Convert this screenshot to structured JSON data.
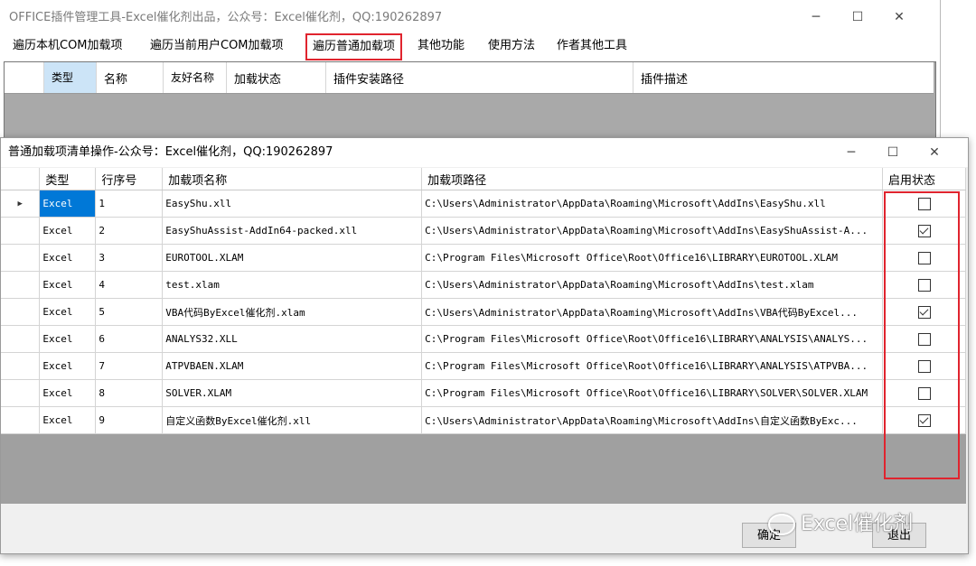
{
  "main_window": {
    "title": "OFFICE插件管理工具-Excel催化剂出品，公众号：Excel催化剂，QQ:190262897",
    "controls": {
      "minimize": "─",
      "maximize": "☐",
      "close": "✕"
    },
    "menu": [
      {
        "label": "遍历本机COM加载项"
      },
      {
        "label": "遍历当前用户COM加载项"
      },
      {
        "label": "遍历普通加载项"
      },
      {
        "label": "其他功能"
      },
      {
        "label": "使用方法"
      },
      {
        "label": "作者其他工具"
      }
    ],
    "grid_headers": [
      "类型",
      "名称",
      "友好名称",
      "加载状态",
      "插件安装路径",
      "插件描述"
    ]
  },
  "dialog": {
    "title": "普通加载项清单操作-公众号：Excel催化剂，QQ:190262897",
    "controls": {
      "minimize": "─",
      "maximize": "☐",
      "close": "✕"
    },
    "columns": [
      "类型",
      "行序号",
      "加载项名称",
      "加载项路径",
      "启用状态"
    ],
    "current_row_marker": "▶",
    "rows": [
      {
        "type": "Excel",
        "index": "1",
        "name": "EasyShu.xll",
        "path": "C:\\Users\\Administrator\\AppData\\Roaming\\Microsoft\\AddIns\\EasyShu.xll",
        "enabled": false
      },
      {
        "type": "Excel",
        "index": "2",
        "name": "EasyShuAssist-AddIn64-packed.xll",
        "path": "C:\\Users\\Administrator\\AppData\\Roaming\\Microsoft\\AddIns\\EasyShuAssist-A...",
        "enabled": true
      },
      {
        "type": "Excel",
        "index": "3",
        "name": "EUROTOOL.XLAM",
        "path": "C:\\Program Files\\Microsoft Office\\Root\\Office16\\LIBRARY\\EUROTOOL.XLAM",
        "enabled": false
      },
      {
        "type": "Excel",
        "index": "4",
        "name": "test.xlam",
        "path": "C:\\Users\\Administrator\\AppData\\Roaming\\Microsoft\\AddIns\\test.xlam",
        "enabled": false
      },
      {
        "type": "Excel",
        "index": "5",
        "name": "VBA代码ByExcel催化剂.xlam",
        "path": "C:\\Users\\Administrator\\AppData\\Roaming\\Microsoft\\AddIns\\VBA代码ByExcel...",
        "enabled": true
      },
      {
        "type": "Excel",
        "index": "6",
        "name": "ANALYS32.XLL",
        "path": "C:\\Program Files\\Microsoft Office\\Root\\Office16\\LIBRARY\\ANALYSIS\\ANALYS...",
        "enabled": false
      },
      {
        "type": "Excel",
        "index": "7",
        "name": "ATPVBAEN.XLAM",
        "path": "C:\\Program Files\\Microsoft Office\\Root\\Office16\\LIBRARY\\ANALYSIS\\ATPVBA...",
        "enabled": false
      },
      {
        "type": "Excel",
        "index": "8",
        "name": "SOLVER.XLAM",
        "path": "C:\\Program Files\\Microsoft Office\\Root\\Office16\\LIBRARY\\SOLVER\\SOLVER.XLAM",
        "enabled": false
      },
      {
        "type": "Excel",
        "index": "9",
        "name": "自定义函数ByExcel催化剂.xll",
        "path": "C:\\Users\\Administrator\\AppData\\Roaming\\Microsoft\\AddIns\\自定义函数ByExc...",
        "enabled": true
      }
    ],
    "buttons": {
      "ok": "确定",
      "exit": "退出"
    }
  },
  "watermark": "Excel催化剂",
  "colors": {
    "highlight_box": "#e0242e",
    "selection": "#0078d7",
    "header_highlight": "#cce4f7"
  }
}
